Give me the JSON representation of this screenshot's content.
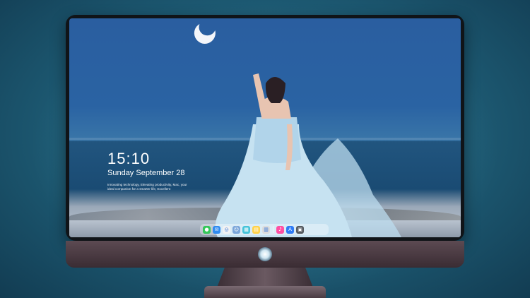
{
  "lockscreen": {
    "time": "15:10",
    "date": "Sunday September 28",
    "tagline": "Innovating technology, Elevating productivity, Mac, your ideal companion for a smarter life, Excellent"
  },
  "dock": {
    "items": [
      {
        "name": "messages-icon",
        "color": "#34c759",
        "glyph": "●"
      },
      {
        "name": "mail-icon",
        "color": "#2f8bf0",
        "glyph": "✉"
      },
      {
        "name": "safari-icon",
        "color": "#f2f2f2",
        "glyph": "◎"
      },
      {
        "name": "finder-icon",
        "color": "#7aa6d9",
        "glyph": "☺"
      },
      {
        "name": "tv-icon",
        "color": "#45c3d9",
        "glyph": "▦"
      },
      {
        "name": "notes-icon",
        "color": "#ffd24a",
        "glyph": "▤"
      },
      {
        "name": "preview-icon",
        "color": "#dcdcdc",
        "glyph": "▥"
      },
      {
        "name": "music-icon",
        "color": "#ff4fa3",
        "glyph": "♪"
      },
      {
        "name": "app-store-icon",
        "color": "#2f7cf6",
        "glyph": "A"
      },
      {
        "name": "camera-icon",
        "color": "#555a60",
        "glyph": "▣"
      }
    ]
  },
  "monitor": {
    "logo_name": "monitor-logo-icon"
  }
}
